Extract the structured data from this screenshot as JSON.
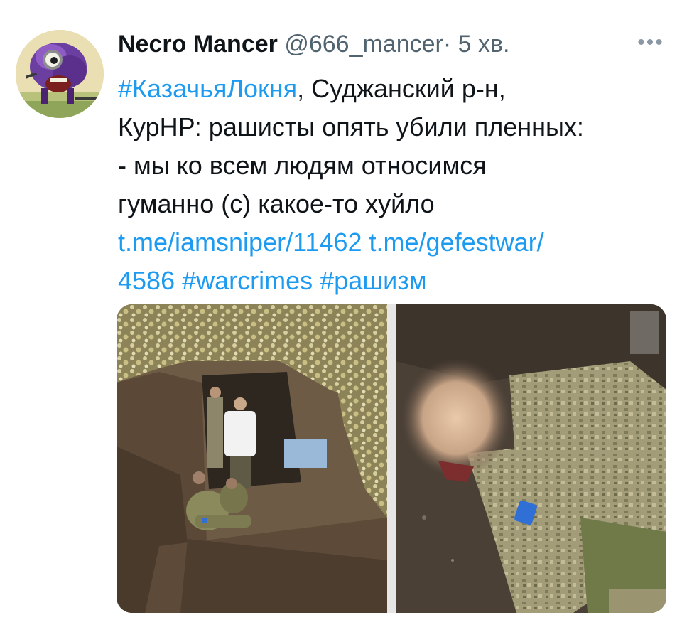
{
  "tweet": {
    "author": {
      "display_name": "Necro Mancer",
      "handle": "@666_mancer",
      "separator": "·",
      "time": "5 хв."
    },
    "more_label": "•••",
    "text": {
      "hashtag_1": "#КазачьяЛокня",
      "line1_rest": ", Суджанский р-н,",
      "line2": "КурНР: рашисты опять убили пленных:",
      "line3": "- мы ко всем людям относимся",
      "line4": "гуманно (с) какое-то хуйло",
      "link_1": "t.me/iamsniper/11462",
      "link_2a": "t.me/gefestwar/",
      "link_2b": "4586",
      "hashtag_2": "#warcrimes",
      "hashtag_3": "#рашизм"
    },
    "media": [
      {
        "type": "photo",
        "icon": "trench-photo"
      },
      {
        "type": "photo",
        "icon": "ground-photo"
      }
    ],
    "colors": {
      "link": "#1d9bf0",
      "secondary_text": "#536471",
      "primary_text": "#0f1419"
    }
  }
}
